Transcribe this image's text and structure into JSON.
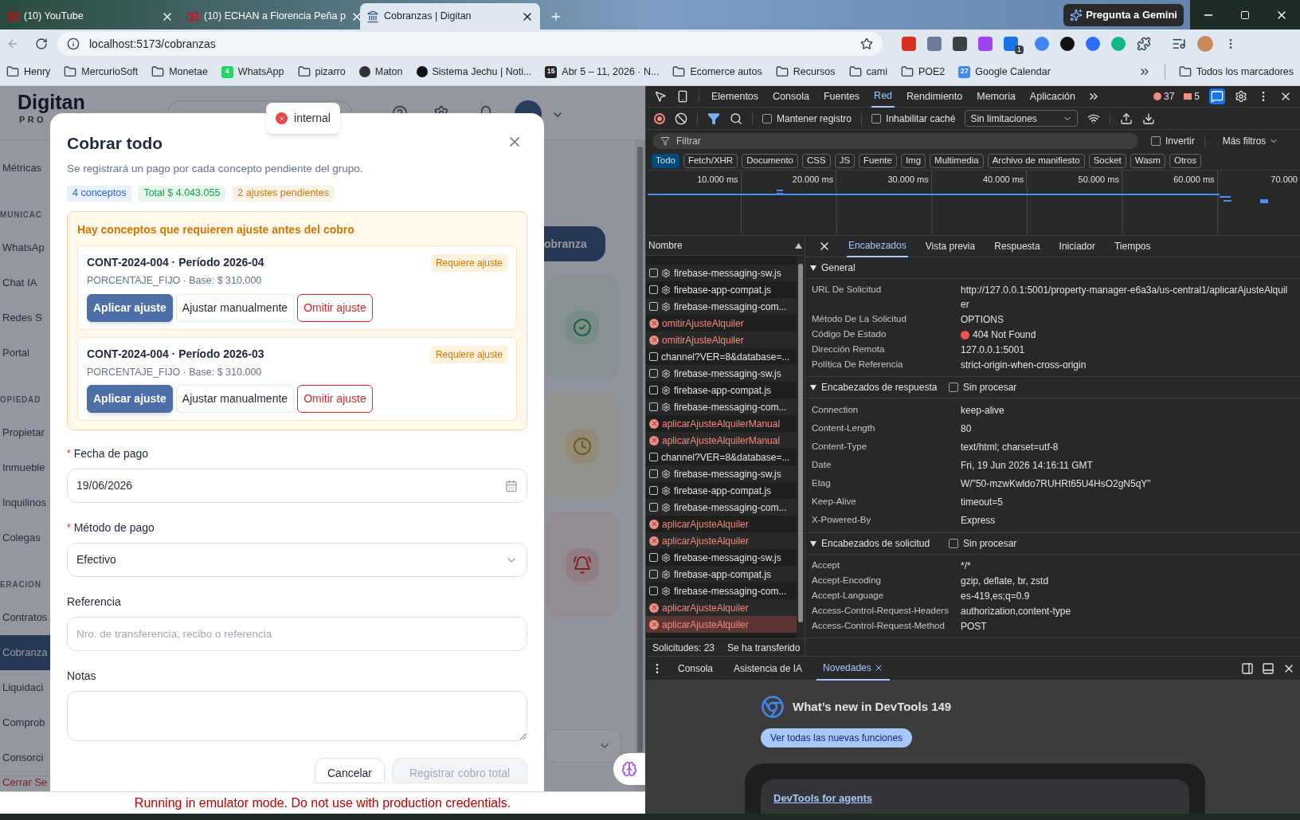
{
  "browser": {
    "tabs": [
      {
        "title": "(10) YouTube",
        "kind": "video",
        "selected": false
      },
      {
        "title": "(10) ECHAN a Florencia Peña p",
        "kind": "video",
        "selected": false
      },
      {
        "title": "Cobranzas | Digitan",
        "kind": "site",
        "selected": true
      }
    ],
    "gemini": "Pregunta a Gemini",
    "url": "localhost:5173/cobranzas",
    "extension_badge": "1",
    "bookmarks": [
      {
        "label": "Henry",
        "kind": "folder"
      },
      {
        "label": "MercurioSoft",
        "kind": "folder"
      },
      {
        "label": "Monetae",
        "kind": "folder"
      },
      {
        "label": "WhatsApp",
        "kind": "badge",
        "badge": "4",
        "color": "#25d366"
      },
      {
        "label": "pizarro",
        "kind": "folder"
      },
      {
        "label": "Maton",
        "kind": "site",
        "color": "#333333"
      },
      {
        "label": "Sistema Jechu | Noti...",
        "kind": "site",
        "color": "#111111"
      },
      {
        "label": "Abr 5 – 11, 2026 · N...",
        "kind": "badge",
        "badge": "15",
        "color": "#222222"
      },
      {
        "label": "Ecomerce autos",
        "kind": "folder"
      },
      {
        "label": "Recursos",
        "kind": "folder"
      },
      {
        "label": "cami",
        "kind": "folder"
      },
      {
        "label": "POE2",
        "kind": "folder"
      },
      {
        "label": "Google Calendar",
        "kind": "badge",
        "badge": "27",
        "color": "#4285f4"
      }
    ],
    "all_bookmarks": "Todos los marcadores"
  },
  "app": {
    "logo": "Digitan",
    "logo_sub": "PRO",
    "sidebar": [
      {
        "label": "Métricas",
        "kind": "item",
        "selected": false
      },
      {
        "label": "MUNICAC",
        "kind": "section"
      },
      {
        "label": "WhatsAp",
        "kind": "item",
        "selected": false
      },
      {
        "label": "Chat IA",
        "kind": "item",
        "selected": false
      },
      {
        "label": "Redes S",
        "kind": "item",
        "selected": false
      },
      {
        "label": "Portal",
        "kind": "item",
        "selected": false
      },
      {
        "label": "OPIEDAD",
        "kind": "section"
      },
      {
        "label": "Propietar",
        "kind": "item",
        "selected": false
      },
      {
        "label": "Inmueble",
        "kind": "item",
        "selected": false
      },
      {
        "label": "Inquilinos",
        "kind": "item",
        "selected": false
      },
      {
        "label": "Colegas",
        "kind": "item",
        "selected": false
      },
      {
        "label": "ERACION",
        "kind": "section"
      },
      {
        "label": "Contratos",
        "kind": "item",
        "selected": false
      },
      {
        "label": "Cobranza",
        "kind": "item",
        "selected": true
      },
      {
        "label": "Liquidaci",
        "kind": "item",
        "selected": false
      },
      {
        "label": "Comprob",
        "kind": "item",
        "selected": false
      },
      {
        "label": "Consorci",
        "kind": "item",
        "selected": false
      },
      {
        "label": "Cerrar Se",
        "kind": "logout"
      }
    ],
    "new_button": "obranza",
    "stat_cards": [
      {
        "kind": "done"
      },
      {
        "kind": "pending"
      },
      {
        "kind": "alert"
      }
    ]
  },
  "toast": {
    "message": "internal"
  },
  "modal": {
    "title": "Cobrar todo",
    "subtitle": "Se registrará un pago por cada concepto pendiente del grupo.",
    "chips": [
      {
        "label": "4 conceptos",
        "color": "#2563eb"
      },
      {
        "label": "Total $ 4.043.055",
        "color": "#16a34a"
      },
      {
        "label": "2 ajustes pendientes",
        "color": "#d97706"
      }
    ],
    "alert_title": "Hay conceptos que requieren ajuste antes del cobro",
    "items": [
      {
        "title": "CONT-2024-004 · Período 2026-04",
        "detail": "PORCENTAJE_FIJO · Base: $ 310.000",
        "badge": "Requiere ajuste",
        "actions": [
          "Aplicar ajuste",
          "Ajustar manualmente",
          "Omitir ajuste"
        ]
      },
      {
        "title": "CONT-2024-004 · Período 2026-03",
        "detail": "PORCENTAJE_FIJO · Base: $ 310.000",
        "badge": "Requiere ajuste",
        "actions": [
          "Aplicar ajuste",
          "Ajustar manualmente",
          "Omitir ajuste"
        ]
      }
    ],
    "fields": [
      {
        "label": "Fecha de pago",
        "required_mark": "*",
        "kind": "date",
        "value": "19/06/2026"
      },
      {
        "label": "Método de pago",
        "required_mark": "*",
        "kind": "select",
        "value": "Efectivo"
      },
      {
        "label": "Referencia",
        "kind": "text",
        "placeholder": "Nro. de transferencia, recibo o referencia"
      },
      {
        "label": "Notas",
        "kind": "textarea"
      }
    ],
    "cancel": "Cancelar",
    "submit": {
      "label": "Registrar cobro total",
      "disabled": true
    }
  },
  "banner": "Running in emulator mode. Do not use with production credentials.",
  "devtools": {
    "tabs": [
      {
        "label": "Elementos",
        "selected": false
      },
      {
        "label": "Consola",
        "selected": false
      },
      {
        "label": "Fuentes",
        "selected": false
      },
      {
        "label": "Red",
        "selected": true
      },
      {
        "label": "Rendimiento",
        "selected": false
      },
      {
        "label": "Memoria",
        "selected": false
      },
      {
        "label": "Aplicación",
        "selected": false
      }
    ],
    "errors": "37",
    "warnings": "5",
    "preserve_log": {
      "label": "Mantener registro",
      "checked": false
    },
    "disable_cache": {
      "label": "Inhabilitar caché",
      "checked": false
    },
    "throttling": "Sin limitaciones",
    "filter_placeholder": "Filtrar",
    "invert": {
      "label": "Invertir",
      "checked": false
    },
    "more_filters": "Más filtros",
    "chips": [
      {
        "label": "Todo",
        "selected": true
      },
      {
        "label": "Fetch/XHR",
        "selected": false
      },
      {
        "label": "Documento",
        "selected": false
      },
      {
        "label": "CSS",
        "selected": false
      },
      {
        "label": "JS",
        "selected": false
      },
      {
        "label": "Fuente",
        "selected": false
      },
      {
        "label": "Img",
        "selected": false
      },
      {
        "label": "Multimedia",
        "selected": false
      },
      {
        "label": "Archivo de manifiesto",
        "selected": false
      },
      {
        "label": "Socket",
        "selected": false
      },
      {
        "label": "Wasm",
        "selected": false
      },
      {
        "label": "Otros",
        "selected": false
      }
    ],
    "timeline_ticks": [
      "10.000 ms",
      "20.000 ms",
      "30.000 ms",
      "40.000 ms",
      "50.000 ms",
      "60.000 ms",
      "70.000"
    ],
    "list_header": "Nombre",
    "requests": [
      {
        "name": "firebase-messaging-sw.js",
        "kind": "document",
        "service_worker": true,
        "selected": false
      },
      {
        "name": "firebase-app-compat.js",
        "kind": "document",
        "service_worker": true,
        "selected": false
      },
      {
        "name": "firebase-messaging-com...",
        "kind": "document",
        "service_worker": true,
        "selected": false
      },
      {
        "name": "omitirAjusteAlquiler",
        "kind": "error",
        "service_worker": false,
        "selected": false
      },
      {
        "name": "omitirAjusteAlquiler",
        "kind": "error",
        "service_worker": false,
        "selected": false
      },
      {
        "name": "channel?VER=8&database=...",
        "kind": "document",
        "service_worker": false,
        "selected": false
      },
      {
        "name": "firebase-messaging-sw.js",
        "kind": "document",
        "service_worker": true,
        "selected": false
      },
      {
        "name": "firebase-app-compat.js",
        "kind": "document",
        "service_worker": true,
        "selected": false
      },
      {
        "name": "firebase-messaging-com...",
        "kind": "document",
        "service_worker": true,
        "selected": false
      },
      {
        "name": "aplicarAjusteAlquilerManual",
        "kind": "error",
        "service_worker": false,
        "selected": false
      },
      {
        "name": "aplicarAjusteAlquilerManual",
        "kind": "error",
        "service_worker": false,
        "selected": false
      },
      {
        "name": "channel?VER=8&database=...",
        "kind": "document",
        "service_worker": false,
        "selected": false
      },
      {
        "name": "firebase-messaging-sw.js",
        "kind": "document",
        "service_worker": true,
        "selected": false
      },
      {
        "name": "firebase-app-compat.js",
        "kind": "document",
        "service_worker": true,
        "selected": false
      },
      {
        "name": "firebase-messaging-com...",
        "kind": "document",
        "service_worker": true,
        "selected": false
      },
      {
        "name": "aplicarAjusteAlquiler",
        "kind": "error",
        "service_worker": false,
        "selected": false
      },
      {
        "name": "aplicarAjusteAlquiler",
        "kind": "error",
        "service_worker": false,
        "selected": false
      },
      {
        "name": "firebase-messaging-sw.js",
        "kind": "document",
        "service_worker": true,
        "selected": false
      },
      {
        "name": "firebase-app-compat.js",
        "kind": "document",
        "service_worker": true,
        "selected": false
      },
      {
        "name": "firebase-messaging-com...",
        "kind": "document",
        "service_worker": true,
        "selected": false
      },
      {
        "name": "aplicarAjusteAlquiler",
        "kind": "error",
        "service_worker": false,
        "selected": false
      },
      {
        "name": "aplicarAjusteAlquiler",
        "kind": "error",
        "service_worker": false,
        "selected": true
      }
    ],
    "summary": [
      "Solicitudes: 23",
      "Se ha transferido"
    ],
    "detail_tabs": [
      {
        "label": "Encabezados",
        "selected": true
      },
      {
        "label": "Vista previa",
        "selected": false
      },
      {
        "label": "Respuesta",
        "selected": false
      },
      {
        "label": "Iniciador",
        "selected": false
      },
      {
        "label": "Tiempos",
        "selected": false
      }
    ],
    "sections": [
      {
        "title": "General",
        "expanded": true,
        "rows": [
          {
            "name": "URL De Solicitud",
            "value": "http://127.0.0.1:5001/property-manager-e6a3a/us-central1/aplicarAjusteAlquiler"
          },
          {
            "name": "Método De La Solicitud",
            "value": "OPTIONS"
          },
          {
            "name": "Código De Estado",
            "value": "404 Not Found",
            "color": "#ef5350"
          },
          {
            "name": "Dirección Remota",
            "value": "127.0.0.1:5001"
          },
          {
            "name": "Política De Referencia",
            "value": "strict-origin-when-cross-origin"
          }
        ]
      },
      {
        "title": "Encabezados de respuesta",
        "expanded": true,
        "raw": {
          "label": "Sin procesar",
          "checked": false
        },
        "rows": [
          {
            "name": "Connection",
            "value": "keep-alive"
          },
          {
            "name": "Content-Length",
            "value": "80"
          },
          {
            "name": "Content-Type",
            "value": "text/html; charset=utf-8"
          },
          {
            "name": "Date",
            "value": "Fri, 19 Jun 2026 14:16:11 GMT"
          },
          {
            "name": "Etag",
            "value": "W/\"50-mzwKwldo7RUHRt65U4HsO2gN5qY\""
          },
          {
            "name": "Keep-Alive",
            "value": "timeout=5"
          },
          {
            "name": "X-Powered-By",
            "value": "Express"
          }
        ]
      },
      {
        "title": "Encabezados de solicitud",
        "expanded": true,
        "raw": {
          "label": "Sin procesar",
          "checked": false
        },
        "rows": [
          {
            "name": "Accept",
            "value": "*/*"
          },
          {
            "name": "Accept-Encoding",
            "value": "gzip, deflate, br, zstd"
          },
          {
            "name": "Accept-Language",
            "value": "es-419,es;q=0.9"
          },
          {
            "name": "Access-Control-Request-Headers",
            "value": "authorization,content-type"
          },
          {
            "name": "Access-Control-Request-Method",
            "value": "POST"
          }
        ]
      }
    ],
    "drawer_tabs": [
      {
        "label": "Consola",
        "selected": false,
        "closable": false
      },
      {
        "label": "Asistencia de IA",
        "selected": false,
        "closable": false
      },
      {
        "label": "Novedades",
        "selected": true,
        "closable": true
      }
    ],
    "whats_new": {
      "title": "What’s new in DevTools 149",
      "button": "Ver todas las nuevas funciones",
      "link": "DevTools for agents"
    }
  }
}
